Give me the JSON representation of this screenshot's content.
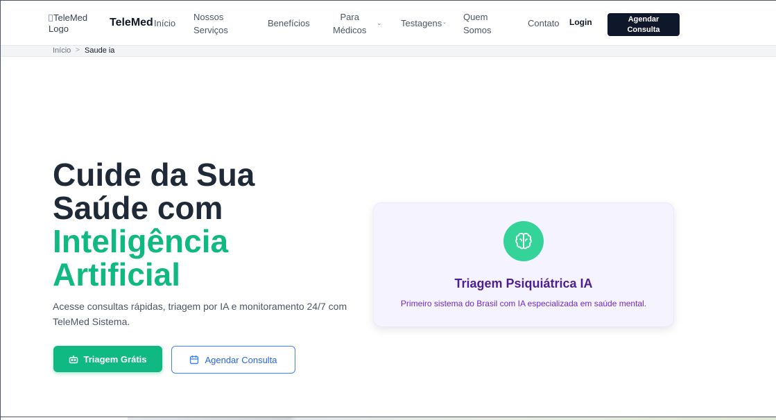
{
  "header": {
    "logo_alt": "TeleMed Logo",
    "brand": "TeleMed",
    "nav": {
      "inicio": "Início",
      "servicos_l1": "Nossos",
      "servicos_l2": "Serviços",
      "beneficios": "Benefícios",
      "medicos_l1": "Para",
      "medicos_l2": "Médicos",
      "testagens": "Testagens",
      "quem_l1": "Quem",
      "quem_l2": "Somos",
      "contato": "Contato"
    },
    "login": "Login",
    "cta_l1": "Agendar",
    "cta_l2": "Consulta"
  },
  "breadcrumb": {
    "home": "Início",
    "separator": ">",
    "current": "Saude ia"
  },
  "hero": {
    "title_l1": "Cuide da Sua",
    "title_l2": "Saúde com",
    "title_accent_l1": "Inteligência",
    "title_accent_l2": "Artificial",
    "subtitle": "Acesse consultas rápidas, triagem por IA e monitoramento 24/7 com TeleMed Sistema.",
    "btn_primary": "Triagem Grátis",
    "btn_primary_icon": "robot-icon",
    "btn_secondary": "Agendar Consulta",
    "btn_secondary_icon": "calendar-icon"
  },
  "feature_card": {
    "icon": "brain-icon",
    "title": "Triagem Psiquiátrica IA",
    "description": "Primeiro sistema do Brasil com IA especializada em saúde mental."
  },
  "colors": {
    "accent_green": "#10b981",
    "dark_button": "#0f172a",
    "card_title": "#4c1d95",
    "outline_blue": "#3b82f6"
  }
}
